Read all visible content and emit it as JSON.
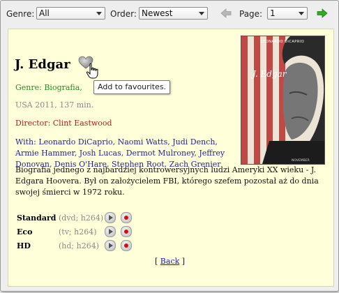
{
  "toolbar": {
    "genre_label": "Genre:",
    "genre_value": "All",
    "order_label": "Order:",
    "order_value": "Newest",
    "page_label": "Page:",
    "page_value": "1",
    "prev_icon": "arrow-left-icon",
    "next_icon": "arrow-right-icon"
  },
  "movie": {
    "title": "J. Edgar",
    "genre": "Genre: Biografia,",
    "meta": "USA 2011, 137 min.",
    "director": "Director: Clint Eastwood",
    "cast": "With: Leonardo DiCaprio, Naomi Watts, Judi Dench, Armie Hammer, Josh Lucas, Dermot Mulroney, Jeffrey Donovan, Denis O'Hare, Stephen Root, Zach Grenier",
    "description": "Biografia jednego z najbardziej kontrowersyjnych ludzi Ameryki XX wieku - J. Edgara Hoovera. Był on założycielem FBI, którego szefem pozostał aż do dnia swojej śmierci w 1972 roku.",
    "favourite_tooltip": "Add to favourites."
  },
  "poster": {
    "top_text": "LEONARDO DiCAPRIO",
    "script_text": "J. Edgar",
    "bottom_text": "NOVEMBER"
  },
  "formats": [
    {
      "name": "Standard",
      "detail": "(dvd; h264)"
    },
    {
      "name": "Eco",
      "detail": "(tv; h264)"
    },
    {
      "name": "HD",
      "detail": "(hd; h264)"
    }
  ],
  "nav": {
    "back_open": "[",
    "back_label": "Back",
    "back_close": "]"
  },
  "colors": {
    "content_bg": "#ffffd9",
    "genre": "#2a8c2a",
    "director": "#aa2222",
    "cast": "#23239b",
    "next_arrow": "#33aa22"
  }
}
